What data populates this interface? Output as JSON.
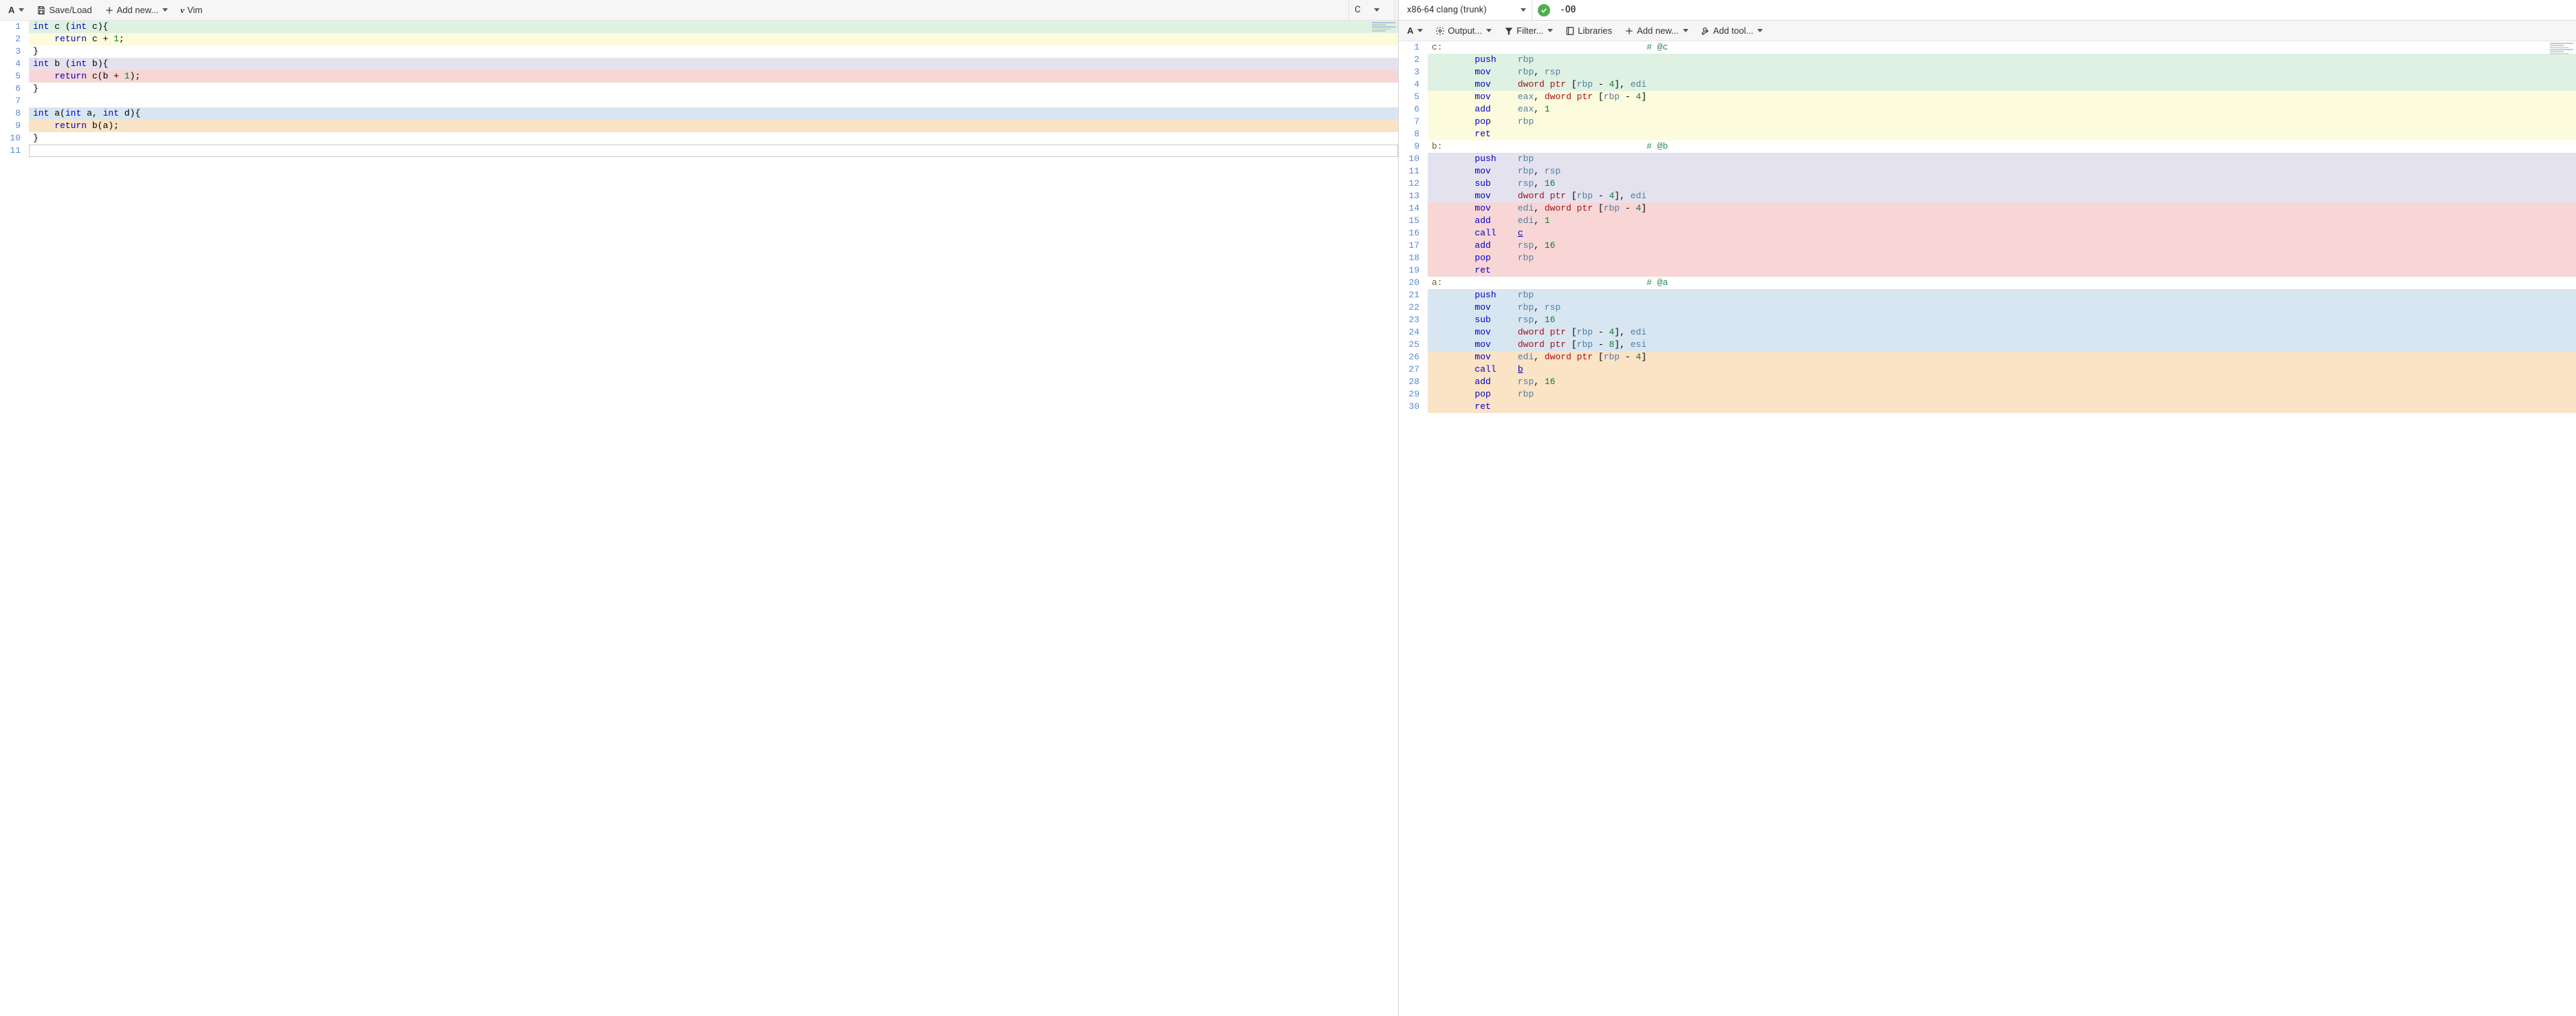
{
  "source_pane": {
    "toolbar": {
      "font_button": "A",
      "save_load": "Save/Load",
      "add_new": "Add new...",
      "vim": "Vim"
    },
    "language_select": {
      "value": "C"
    },
    "lines": [
      {
        "n": 1,
        "bg": "green",
        "tokens": [
          [
            "typ",
            "int"
          ],
          [
            "sp",
            " "
          ],
          [
            "fn",
            "c"
          ],
          [
            "sp",
            " "
          ],
          [
            "punc",
            "("
          ],
          [
            "typ",
            "int"
          ],
          [
            "sp",
            " "
          ],
          [
            "fn",
            "c"
          ],
          [
            "punc",
            ")"
          ],
          [
            "punc",
            "{"
          ]
        ]
      },
      {
        "n": 2,
        "bg": "yellow",
        "tokens": [
          [
            "sp",
            "    "
          ],
          [
            "kw",
            "return"
          ],
          [
            "sp",
            " "
          ],
          [
            "fn",
            "c"
          ],
          [
            "sp",
            " "
          ],
          [
            "op",
            "+"
          ],
          [
            "sp",
            " "
          ],
          [
            "num",
            "1"
          ],
          [
            "punc",
            ";"
          ]
        ]
      },
      {
        "n": 3,
        "bg": "none",
        "tokens": [
          [
            "punc",
            "}"
          ]
        ]
      },
      {
        "n": 4,
        "bg": "lav",
        "tokens": [
          [
            "typ",
            "int"
          ],
          [
            "sp",
            " "
          ],
          [
            "fn",
            "b"
          ],
          [
            "sp",
            " "
          ],
          [
            "punc",
            "("
          ],
          [
            "typ",
            "int"
          ],
          [
            "sp",
            " "
          ],
          [
            "fn",
            "b"
          ],
          [
            "punc",
            ")"
          ],
          [
            "punc",
            "{"
          ]
        ]
      },
      {
        "n": 5,
        "bg": "red",
        "tokens": [
          [
            "sp",
            "    "
          ],
          [
            "kw",
            "return"
          ],
          [
            "sp",
            " "
          ],
          [
            "fn",
            "c"
          ],
          [
            "punc",
            "("
          ],
          [
            "fn",
            "b"
          ],
          [
            "sp",
            " "
          ],
          [
            "op",
            "+"
          ],
          [
            "sp",
            " "
          ],
          [
            "num",
            "1"
          ],
          [
            "punc",
            ")"
          ],
          [
            "punc",
            ";"
          ]
        ]
      },
      {
        "n": 6,
        "bg": "none",
        "tokens": [
          [
            "punc",
            "}"
          ]
        ]
      },
      {
        "n": 7,
        "bg": "none",
        "tokens": []
      },
      {
        "n": 8,
        "bg": "blue",
        "tokens": [
          [
            "typ",
            "int"
          ],
          [
            "sp",
            " "
          ],
          [
            "fn",
            "a"
          ],
          [
            "punc",
            "("
          ],
          [
            "typ",
            "int"
          ],
          [
            "sp",
            " "
          ],
          [
            "fn",
            "a"
          ],
          [
            "punc",
            ","
          ],
          [
            "sp",
            " "
          ],
          [
            "typ",
            "int"
          ],
          [
            "sp",
            " "
          ],
          [
            "fn",
            "d"
          ],
          [
            "punc",
            ")"
          ],
          [
            "punc",
            "{"
          ]
        ]
      },
      {
        "n": 9,
        "bg": "orange",
        "tokens": [
          [
            "sp",
            "    "
          ],
          [
            "kw",
            "return"
          ],
          [
            "sp",
            " "
          ],
          [
            "fn",
            "b"
          ],
          [
            "punc",
            "("
          ],
          [
            "fn",
            "a"
          ],
          [
            "punc",
            ")"
          ],
          [
            "punc",
            ";"
          ]
        ]
      },
      {
        "n": 10,
        "bg": "none",
        "tokens": [
          [
            "punc",
            "}"
          ]
        ]
      },
      {
        "n": 11,
        "bg": "none",
        "tokens": [],
        "active": true
      }
    ]
  },
  "asm_pane": {
    "topbar": {
      "compiler_select": "x86-64 clang (trunk)",
      "options_value": "-O0"
    },
    "toolbar": {
      "font_button": "A",
      "output": "Output...",
      "filter": "Filter...",
      "libraries": "Libraries",
      "add_new": "Add new...",
      "add_tool": "Add tool..."
    },
    "lines": [
      {
        "n": 1,
        "bg": "none",
        "tokens": [
          [
            "lbl",
            "c:"
          ],
          [
            "cmtpad",
            ""
          ],
          [
            "cmt",
            "# @c"
          ]
        ]
      },
      {
        "n": 2,
        "bg": "green",
        "tokens": [
          [
            "pad",
            ""
          ],
          [
            "opcode",
            "push"
          ],
          [
            "tab",
            ""
          ],
          [
            "reg",
            "rbp"
          ]
        ]
      },
      {
        "n": 3,
        "bg": "green",
        "tokens": [
          [
            "pad",
            ""
          ],
          [
            "opcode",
            "mov"
          ],
          [
            "tab",
            ""
          ],
          [
            "reg",
            "rbp"
          ],
          [
            "punc",
            ", "
          ],
          [
            "reg",
            "rsp"
          ]
        ]
      },
      {
        "n": 4,
        "bg": "green",
        "tokens": [
          [
            "pad",
            ""
          ],
          [
            "opcode",
            "mov"
          ],
          [
            "tab",
            ""
          ],
          [
            "addr",
            "dword ptr"
          ],
          [
            "punc",
            " ["
          ],
          [
            "reg",
            "rbp"
          ],
          [
            "punc",
            " - "
          ],
          [
            "num",
            "4"
          ],
          [
            "punc",
            "], "
          ],
          [
            "reg",
            "edi"
          ]
        ]
      },
      {
        "n": 5,
        "bg": "yellow",
        "tokens": [
          [
            "pad",
            ""
          ],
          [
            "opcode",
            "mov"
          ],
          [
            "tab",
            ""
          ],
          [
            "reg",
            "eax"
          ],
          [
            "punc",
            ", "
          ],
          [
            "addr",
            "dword ptr"
          ],
          [
            "punc",
            " ["
          ],
          [
            "reg",
            "rbp"
          ],
          [
            "punc",
            " - "
          ],
          [
            "num",
            "4"
          ],
          [
            "punc",
            "]"
          ]
        ]
      },
      {
        "n": 6,
        "bg": "yellow",
        "tokens": [
          [
            "pad",
            ""
          ],
          [
            "opcode",
            "add"
          ],
          [
            "tab",
            ""
          ],
          [
            "reg",
            "eax"
          ],
          [
            "punc",
            ", "
          ],
          [
            "num",
            "1"
          ]
        ]
      },
      {
        "n": 7,
        "bg": "yellow",
        "tokens": [
          [
            "pad",
            ""
          ],
          [
            "opcode",
            "pop"
          ],
          [
            "tab",
            ""
          ],
          [
            "reg",
            "rbp"
          ]
        ]
      },
      {
        "n": 8,
        "bg": "yellow",
        "tokens": [
          [
            "pad",
            ""
          ],
          [
            "opcode",
            "ret"
          ]
        ]
      },
      {
        "n": 9,
        "bg": "none",
        "tokens": [
          [
            "lbl",
            "b:"
          ],
          [
            "cmtpad",
            ""
          ],
          [
            "cmt",
            "# @b"
          ]
        ]
      },
      {
        "n": 10,
        "bg": "lav",
        "tokens": [
          [
            "pad",
            ""
          ],
          [
            "opcode",
            "push"
          ],
          [
            "tab",
            ""
          ],
          [
            "reg",
            "rbp"
          ]
        ]
      },
      {
        "n": 11,
        "bg": "lav",
        "tokens": [
          [
            "pad",
            ""
          ],
          [
            "opcode",
            "mov"
          ],
          [
            "tab",
            ""
          ],
          [
            "reg",
            "rbp"
          ],
          [
            "punc",
            ", "
          ],
          [
            "reg",
            "rsp"
          ]
        ]
      },
      {
        "n": 12,
        "bg": "lav",
        "tokens": [
          [
            "pad",
            ""
          ],
          [
            "opcode",
            "sub"
          ],
          [
            "tab",
            ""
          ],
          [
            "reg",
            "rsp"
          ],
          [
            "punc",
            ", "
          ],
          [
            "num",
            "16"
          ]
        ]
      },
      {
        "n": 13,
        "bg": "lav",
        "tokens": [
          [
            "pad",
            ""
          ],
          [
            "opcode",
            "mov"
          ],
          [
            "tab",
            ""
          ],
          [
            "addr",
            "dword ptr"
          ],
          [
            "punc",
            " ["
          ],
          [
            "reg",
            "rbp"
          ],
          [
            "punc",
            " - "
          ],
          [
            "num",
            "4"
          ],
          [
            "punc",
            "], "
          ],
          [
            "reg",
            "edi"
          ]
        ]
      },
      {
        "n": 14,
        "bg": "red",
        "tokens": [
          [
            "pad",
            ""
          ],
          [
            "opcode",
            "mov"
          ],
          [
            "tab",
            ""
          ],
          [
            "reg",
            "edi"
          ],
          [
            "punc",
            ", "
          ],
          [
            "addr",
            "dword ptr"
          ],
          [
            "punc",
            " ["
          ],
          [
            "reg",
            "rbp"
          ],
          [
            "punc",
            " - "
          ],
          [
            "num",
            "4"
          ],
          [
            "punc",
            "]"
          ]
        ]
      },
      {
        "n": 15,
        "bg": "red",
        "tokens": [
          [
            "pad",
            ""
          ],
          [
            "opcode",
            "add"
          ],
          [
            "tab",
            ""
          ],
          [
            "reg",
            "edi"
          ],
          [
            "punc",
            ", "
          ],
          [
            "num",
            "1"
          ]
        ]
      },
      {
        "n": 16,
        "bg": "red",
        "tokens": [
          [
            "pad",
            ""
          ],
          [
            "opcode",
            "call"
          ],
          [
            "tab",
            ""
          ],
          [
            "callt",
            "c"
          ]
        ]
      },
      {
        "n": 17,
        "bg": "red",
        "tokens": [
          [
            "pad",
            ""
          ],
          [
            "opcode",
            "add"
          ],
          [
            "tab",
            ""
          ],
          [
            "reg",
            "rsp"
          ],
          [
            "punc",
            ", "
          ],
          [
            "num",
            "16"
          ]
        ]
      },
      {
        "n": 18,
        "bg": "red",
        "tokens": [
          [
            "pad",
            ""
          ],
          [
            "opcode",
            "pop"
          ],
          [
            "tab",
            ""
          ],
          [
            "reg",
            "rbp"
          ]
        ]
      },
      {
        "n": 19,
        "bg": "red",
        "tokens": [
          [
            "pad",
            ""
          ],
          [
            "opcode",
            "ret"
          ]
        ]
      },
      {
        "n": 20,
        "bg": "none",
        "tokens": [
          [
            "lbl",
            "a:"
          ],
          [
            "cmtpad",
            ""
          ],
          [
            "cmt",
            "# @a"
          ]
        ]
      },
      {
        "n": 21,
        "bg": "blue",
        "tokens": [
          [
            "pad",
            ""
          ],
          [
            "opcode",
            "push"
          ],
          [
            "tab",
            ""
          ],
          [
            "reg",
            "rbp"
          ]
        ]
      },
      {
        "n": 22,
        "bg": "blue",
        "tokens": [
          [
            "pad",
            ""
          ],
          [
            "opcode",
            "mov"
          ],
          [
            "tab",
            ""
          ],
          [
            "reg",
            "rbp"
          ],
          [
            "punc",
            ", "
          ],
          [
            "reg",
            "rsp"
          ]
        ]
      },
      {
        "n": 23,
        "bg": "blue",
        "tokens": [
          [
            "pad",
            ""
          ],
          [
            "opcode",
            "sub"
          ],
          [
            "tab",
            ""
          ],
          [
            "reg",
            "rsp"
          ],
          [
            "punc",
            ", "
          ],
          [
            "num",
            "16"
          ]
        ]
      },
      {
        "n": 24,
        "bg": "blue",
        "tokens": [
          [
            "pad",
            ""
          ],
          [
            "opcode",
            "mov"
          ],
          [
            "tab",
            ""
          ],
          [
            "addr",
            "dword ptr"
          ],
          [
            "punc",
            " ["
          ],
          [
            "reg",
            "rbp"
          ],
          [
            "punc",
            " - "
          ],
          [
            "num",
            "4"
          ],
          [
            "punc",
            "], "
          ],
          [
            "reg",
            "edi"
          ]
        ]
      },
      {
        "n": 25,
        "bg": "blue",
        "tokens": [
          [
            "pad",
            ""
          ],
          [
            "opcode",
            "mov"
          ],
          [
            "tab",
            ""
          ],
          [
            "addr",
            "dword ptr"
          ],
          [
            "punc",
            " ["
          ],
          [
            "reg",
            "rbp"
          ],
          [
            "punc",
            " - "
          ],
          [
            "num",
            "8"
          ],
          [
            "punc",
            "], "
          ],
          [
            "reg",
            "esi"
          ]
        ]
      },
      {
        "n": 26,
        "bg": "orange",
        "tokens": [
          [
            "pad",
            ""
          ],
          [
            "opcode",
            "mov"
          ],
          [
            "tab",
            ""
          ],
          [
            "reg",
            "edi"
          ],
          [
            "punc",
            ", "
          ],
          [
            "addr",
            "dword ptr"
          ],
          [
            "punc",
            " ["
          ],
          [
            "reg",
            "rbp"
          ],
          [
            "punc",
            " - "
          ],
          [
            "num",
            "4"
          ],
          [
            "punc",
            "]"
          ]
        ]
      },
      {
        "n": 27,
        "bg": "orange",
        "tokens": [
          [
            "pad",
            ""
          ],
          [
            "opcode",
            "call"
          ],
          [
            "tab",
            ""
          ],
          [
            "callt",
            "b"
          ]
        ]
      },
      {
        "n": 28,
        "bg": "orange",
        "tokens": [
          [
            "pad",
            ""
          ],
          [
            "opcode",
            "add"
          ],
          [
            "tab",
            ""
          ],
          [
            "reg",
            "rsp"
          ],
          [
            "punc",
            ", "
          ],
          [
            "num",
            "16"
          ]
        ]
      },
      {
        "n": 29,
        "bg": "orange",
        "tokens": [
          [
            "pad",
            ""
          ],
          [
            "opcode",
            "pop"
          ],
          [
            "tab",
            ""
          ],
          [
            "reg",
            "rbp"
          ]
        ]
      },
      {
        "n": 30,
        "bg": "orange",
        "tokens": [
          [
            "pad",
            ""
          ],
          [
            "opcode",
            "ret"
          ]
        ]
      }
    ]
  }
}
